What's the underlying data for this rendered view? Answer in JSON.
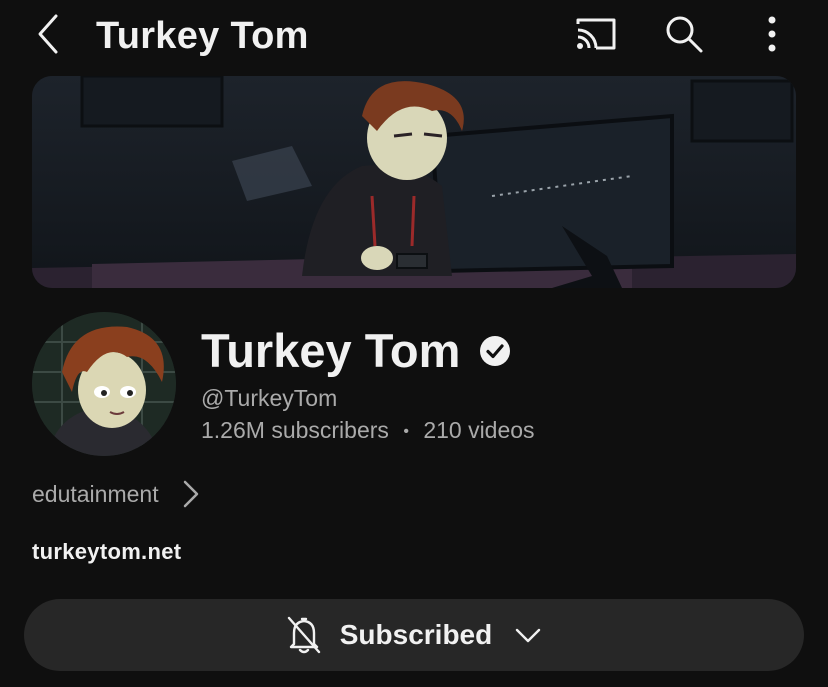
{
  "topbar": {
    "title": "Turkey Tom",
    "icons": [
      "back-icon",
      "cast-icon",
      "search-icon",
      "more-vert-icon"
    ]
  },
  "channel": {
    "name": "Turkey Tom",
    "verified": true,
    "handle": "@TurkeyTom",
    "subscribers": "1.26M subscribers",
    "separator": "•",
    "videos": "210 videos",
    "description": "edutainment",
    "link": "turkeytom.net"
  },
  "subscribe_button": {
    "label": "Subscribed",
    "icons": [
      "bell-off-icon",
      "chevron-down-icon"
    ]
  },
  "colors": {
    "background": "#0f0f0f",
    "primary_text": "#f1f1f1",
    "secondary_text": "#aaaaaa",
    "button_bg": "#272727"
  }
}
